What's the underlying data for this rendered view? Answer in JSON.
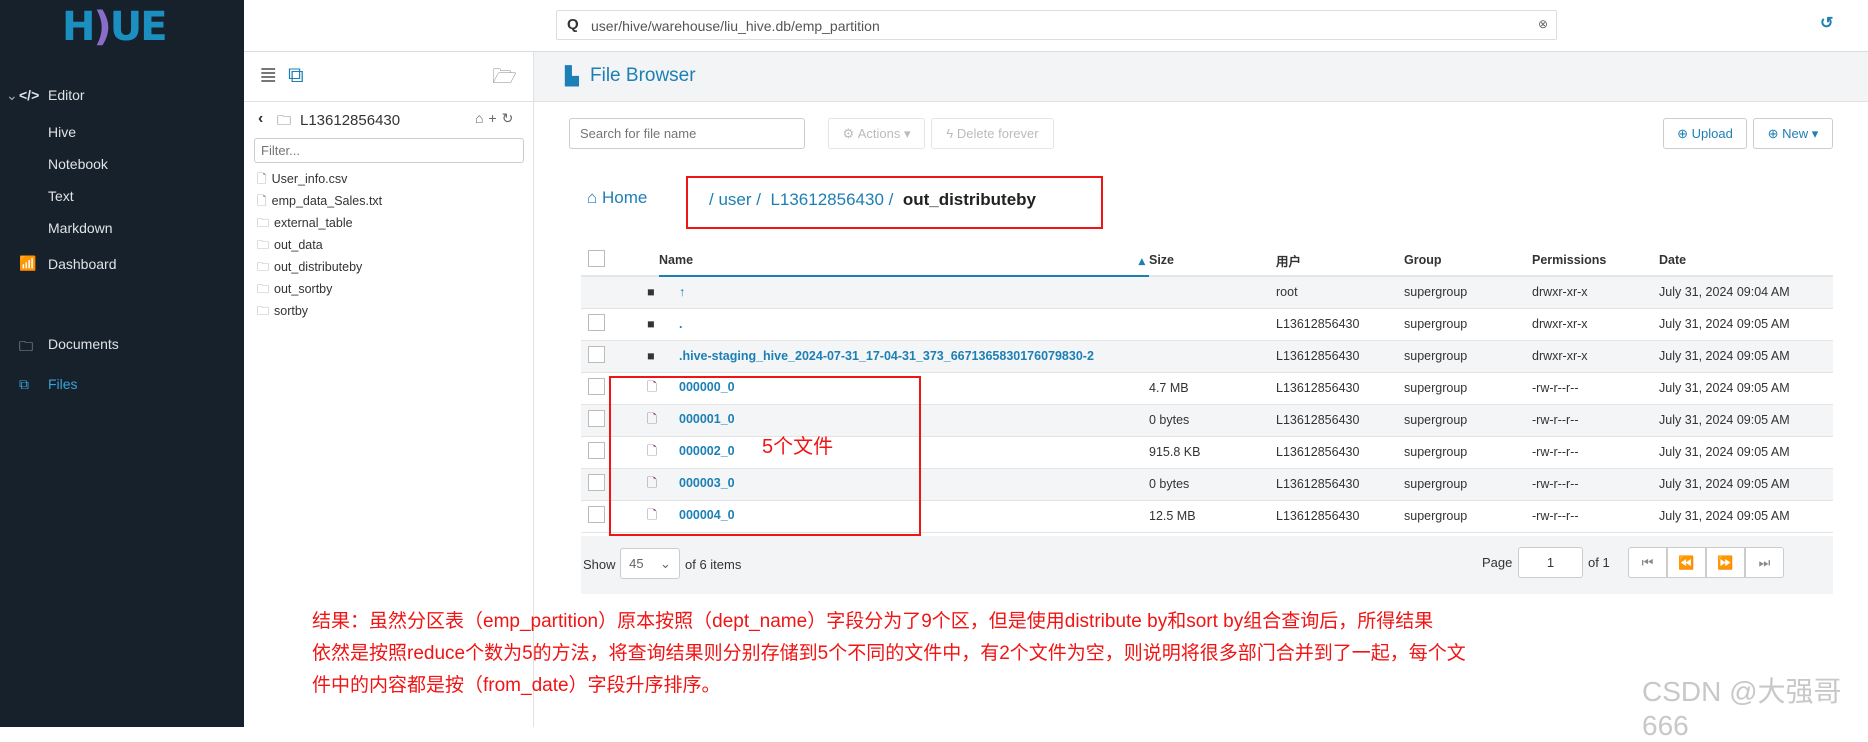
{
  "sidebar": {
    "logo": "HUE",
    "items": [
      {
        "label": "Editor",
        "icon": "code-icon"
      },
      {
        "label": "Hive"
      },
      {
        "label": "Notebook"
      },
      {
        "label": "Text"
      },
      {
        "label": "Markdown"
      },
      {
        "label": "Dashboard",
        "icon": "chart-icon"
      },
      {
        "label": "Documents",
        "icon": "folder-icon"
      },
      {
        "label": "Files",
        "icon": "files-icon",
        "active": true
      }
    ]
  },
  "topbar": {
    "search_value": "user/hive/warehouse/liu_hive.db/emp_partition"
  },
  "left_panel": {
    "current_dir": "L13612856430",
    "filter_placeholder": "Filter...",
    "files": [
      {
        "name": "User_info.csv",
        "type": "file"
      },
      {
        "name": "emp_data_Sales.txt",
        "type": "file"
      },
      {
        "name": "external_table",
        "type": "folder"
      },
      {
        "name": "out_data",
        "type": "folder"
      },
      {
        "name": "out_distributeby",
        "type": "folder"
      },
      {
        "name": "out_sortby",
        "type": "folder"
      },
      {
        "name": "sortby",
        "type": "folder"
      }
    ]
  },
  "main": {
    "title": "File Browser",
    "search_placeholder": "Search for file name",
    "actions_label": "Actions",
    "delete_label": "Delete forever",
    "upload_label": "Upload",
    "new_label": "New",
    "home_label": "Home",
    "breadcrumb": [
      "user",
      "L13612856430",
      "out_distributeby"
    ],
    "columns": [
      "Name",
      "Size",
      "用户",
      "Group",
      "Permissions",
      "Date"
    ],
    "rows": [
      {
        "name": "↑",
        "size": "",
        "user": "root",
        "group": "supergroup",
        "perm": "drwxr-xr-x",
        "date": "July 31, 2024 09:04 AM",
        "type": "dir",
        "checkbox": false
      },
      {
        "name": ".",
        "size": "",
        "user": "L13612856430",
        "group": "supergroup",
        "perm": "drwxr-xr-x",
        "date": "July 31, 2024 09:05 AM",
        "type": "dir",
        "checkbox": true
      },
      {
        "name": ".hive-staging_hive_2024-07-31_17-04-31_373_6671365830176079830-2",
        "size": "",
        "user": "L13612856430",
        "group": "supergroup",
        "perm": "drwxr-xr-x",
        "date": "July 31, 2024 09:05 AM",
        "type": "dir",
        "checkbox": true
      },
      {
        "name": "000000_0",
        "size": "4.7 MB",
        "user": "L13612856430",
        "group": "supergroup",
        "perm": "-rw-r--r--",
        "date": "July 31, 2024 09:05 AM",
        "type": "file",
        "checkbox": true
      },
      {
        "name": "000001_0",
        "size": "0 bytes",
        "user": "L13612856430",
        "group": "supergroup",
        "perm": "-rw-r--r--",
        "date": "July 31, 2024 09:05 AM",
        "type": "file",
        "checkbox": true
      },
      {
        "name": "000002_0",
        "size": "915.8 KB",
        "user": "L13612856430",
        "group": "supergroup",
        "perm": "-rw-r--r--",
        "date": "July 31, 2024 09:05 AM",
        "type": "file",
        "checkbox": true
      },
      {
        "name": "000003_0",
        "size": "0 bytes",
        "user": "L13612856430",
        "group": "supergroup",
        "perm": "-rw-r--r--",
        "date": "July 31, 2024 09:05 AM",
        "type": "file",
        "checkbox": true
      },
      {
        "name": "000004_0",
        "size": "12.5 MB",
        "user": "L13612856430",
        "group": "supergroup",
        "perm": "-rw-r--r--",
        "date": "July 31, 2024 09:05 AM",
        "type": "file",
        "checkbox": true
      }
    ],
    "footer": {
      "show_label": "Show",
      "page_size": "45",
      "items_label": "of 6 items",
      "page_label": "Page",
      "page": "1",
      "of_pages": "of 1"
    }
  },
  "annotations": {
    "files_label": "5个文件",
    "note_lines": [
      "结果：虽然分区表（emp_partition）原本按照（dept_name）字段分为了9个区，但是使用distribute by和sort by组合查询后，所得结果",
      "依然是按照reduce个数为5的方法，将查询结果则分别存储到5个不同的文件中，有2个文件为空，则说明将很多部门合并到了一起，每个文",
      "件中的内容都是按（from_date）字段升序排序。"
    ],
    "watermark": "CSDN @大强哥666"
  },
  "colors": {
    "sidebar": "#17212b",
    "link": "#1c7fb5",
    "annotation": "#f01414"
  }
}
